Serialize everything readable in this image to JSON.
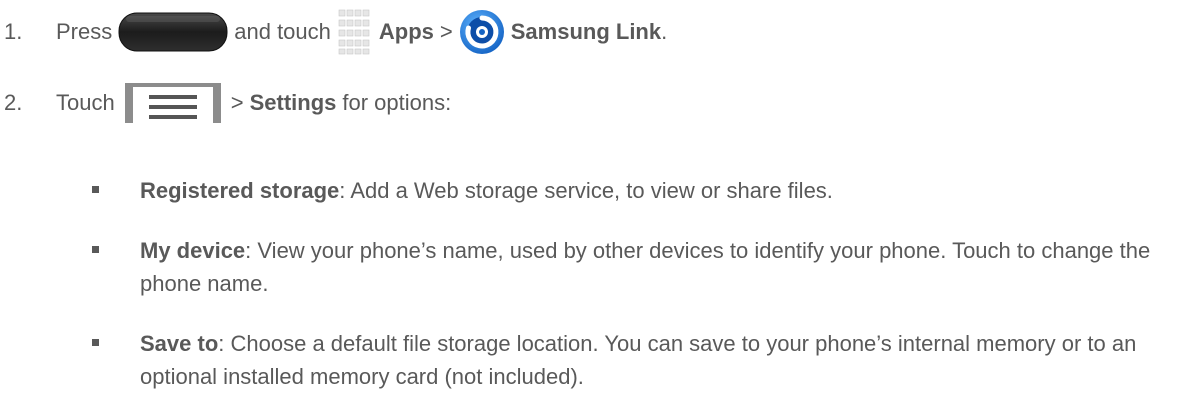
{
  "step1": {
    "num": "1.",
    "press": "Press",
    "and_touch": "and touch",
    "apps": "Apps",
    "sep": ">",
    "samsung_link": "Samsung Link",
    "period": "."
  },
  "step2": {
    "num": "2.",
    "touch": "Touch",
    "sep": ">",
    "settings": "Settings",
    "for_options": "for options:"
  },
  "bullets": [
    {
      "term": "Registered storage",
      "colon": ":",
      "desc": " Add a Web storage service, to view or share files."
    },
    {
      "term": "My device",
      "colon": ":",
      "desc": " View your phone’s name, used by other devices to identify your phone. Touch to change the phone name."
    },
    {
      "term": "Save to",
      "colon": ":",
      "desc": " Choose a default file storage location. You can save to your phone’s internal memory or to an optional installed memory card (not included)."
    }
  ],
  "icons": {
    "home_key": "home-key-icon",
    "apps": "apps-grid-icon",
    "samsung_link": "samsung-link-icon",
    "menu_key": "menu-key-icon"
  },
  "colors": {
    "text": "#595959",
    "link_blue": "#1f7fd6"
  }
}
